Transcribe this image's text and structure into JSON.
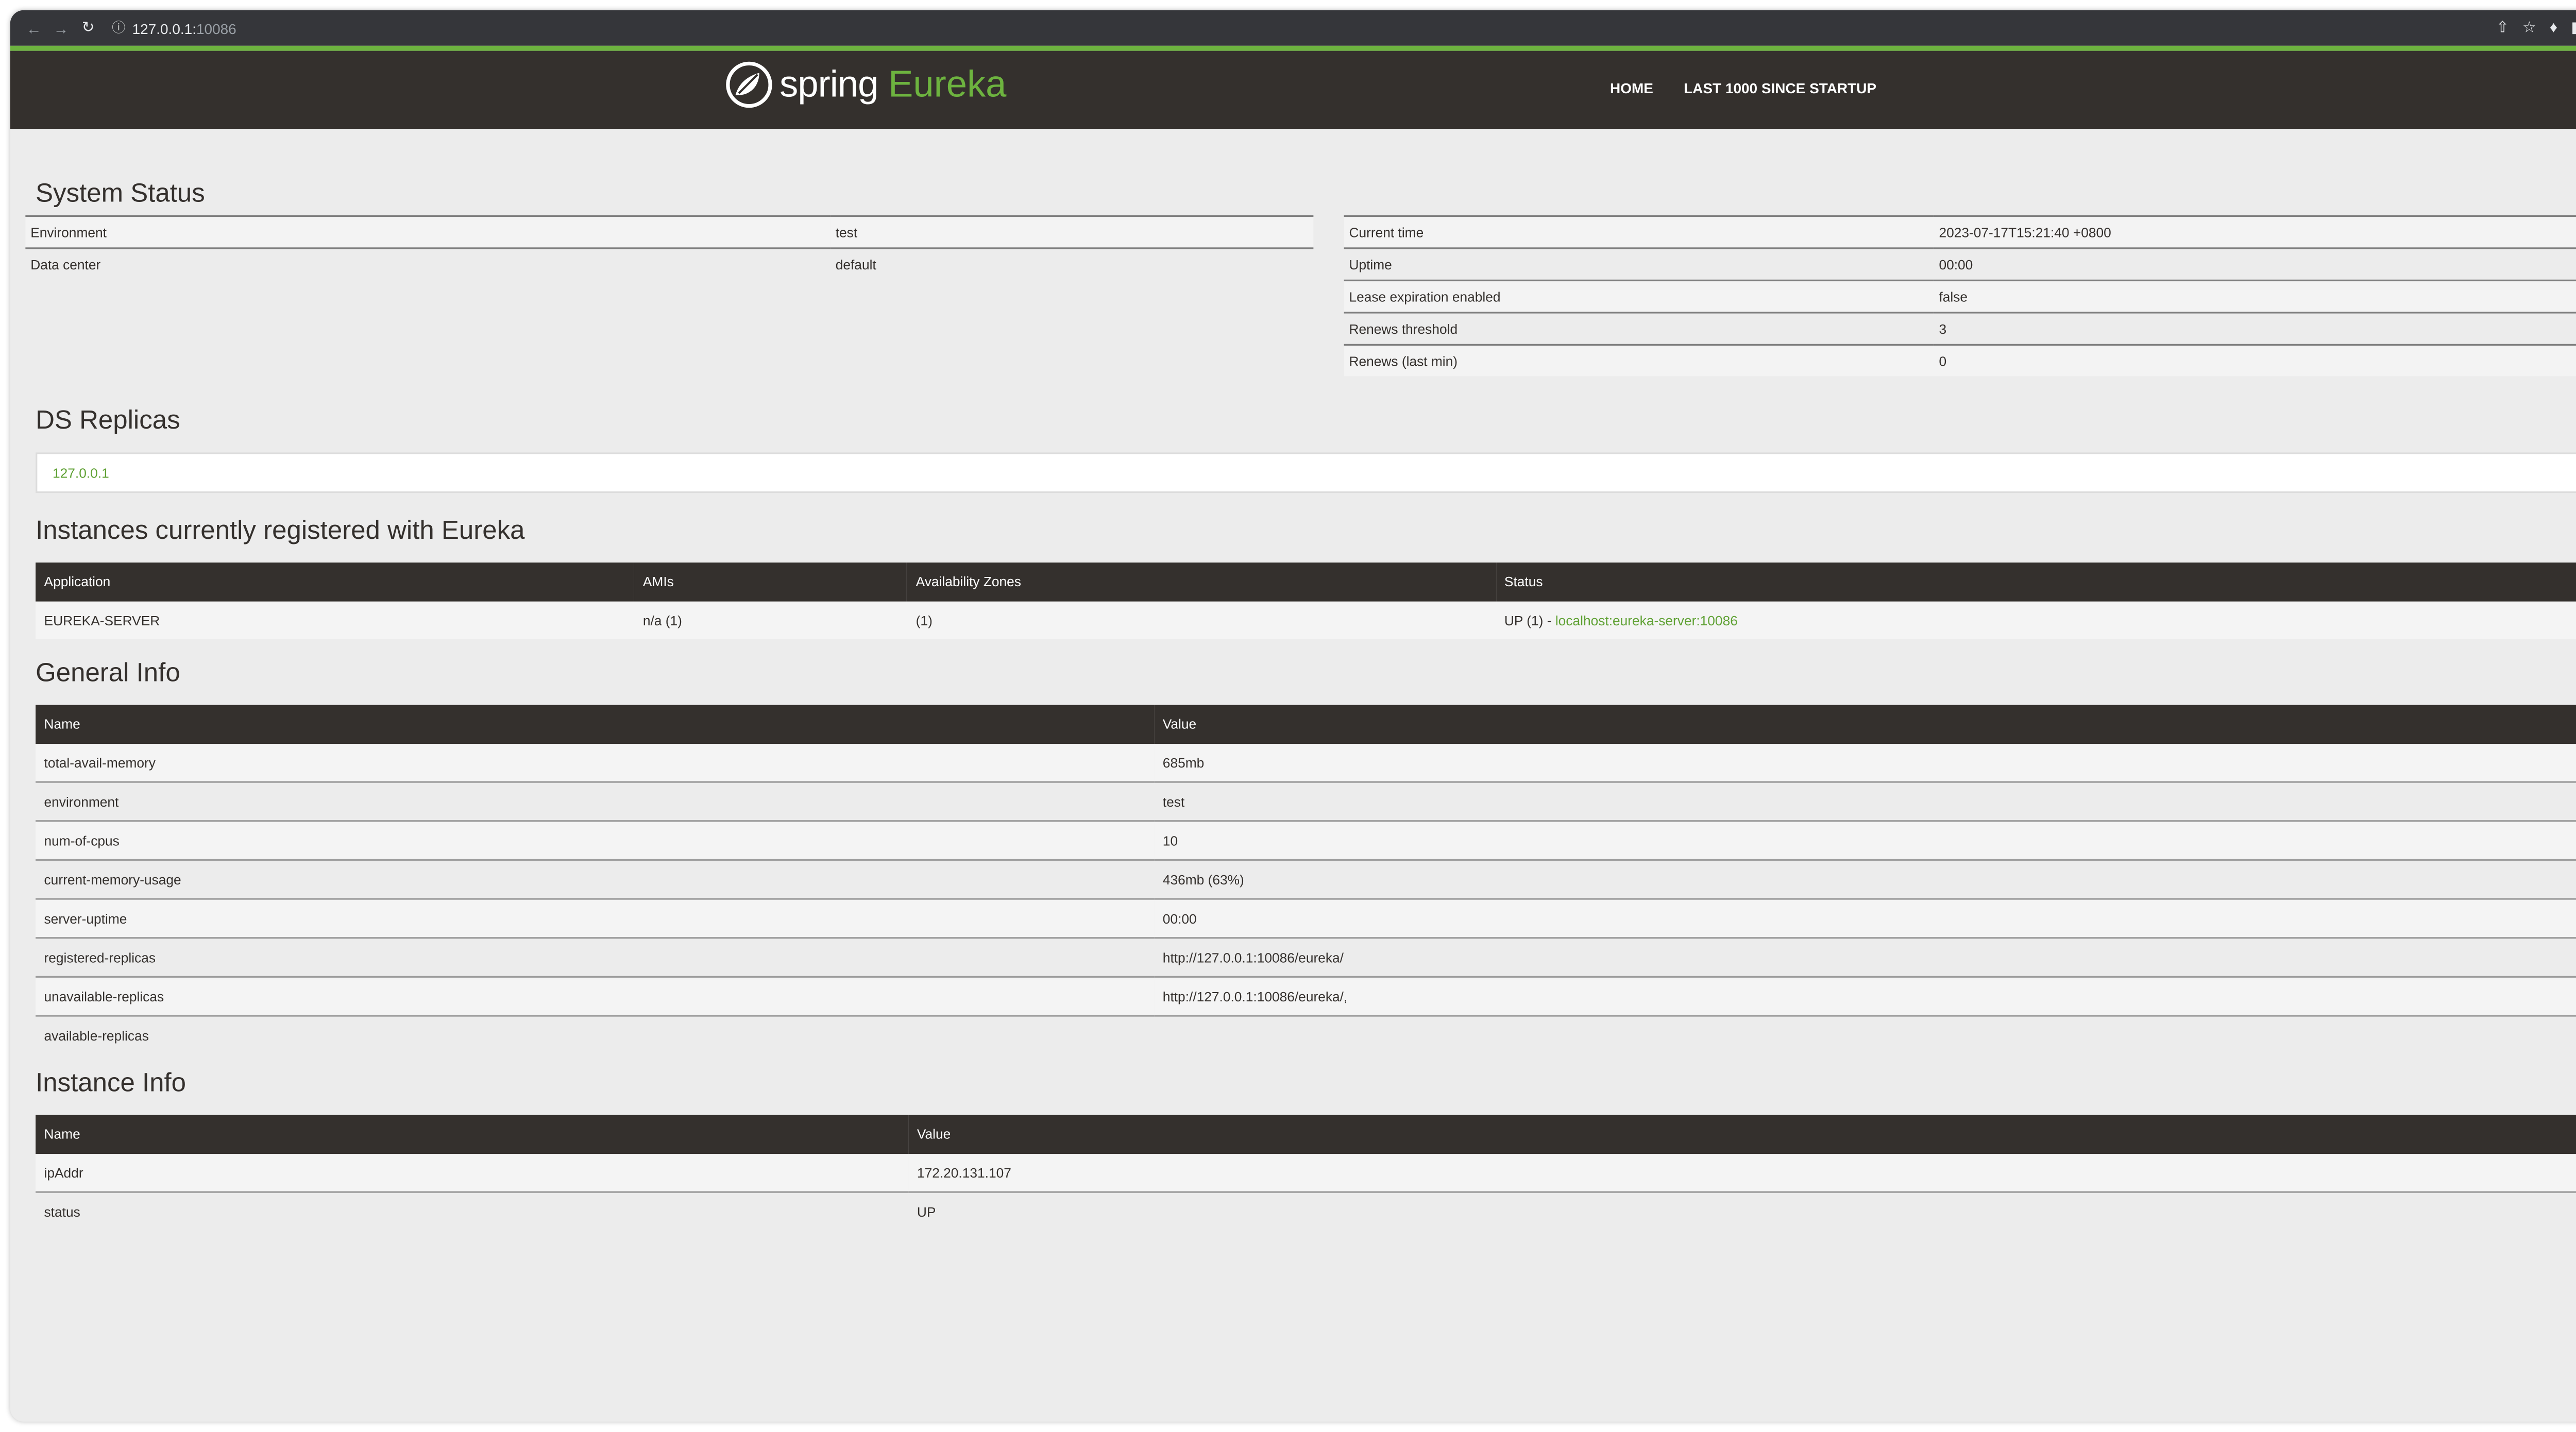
{
  "browser": {
    "url_host": "127.0.0.1:",
    "url_port": "10086",
    "icons": [
      "back-icon",
      "forward-icon",
      "reload-icon",
      "info-icon",
      "share-icon",
      "star-icon",
      "extensions-icon",
      "sidebar-icon",
      "profile-icon",
      "menu-icon"
    ]
  },
  "header": {
    "logo_spring": "spring",
    "logo_eureka": "Eureka",
    "nav": [
      "HOME",
      "LAST 1000 SINCE STARTUP"
    ]
  },
  "system_status": {
    "title": "System Status",
    "left": [
      {
        "key": "Environment",
        "value": "test"
      },
      {
        "key": "Data center",
        "value": "default"
      }
    ],
    "right": [
      {
        "key": "Current time",
        "value": "2023-07-17T15:21:40 +0800"
      },
      {
        "key": "Uptime",
        "value": "00:00"
      },
      {
        "key": "Lease expiration enabled",
        "value": "false"
      },
      {
        "key": "Renews threshold",
        "value": "3"
      },
      {
        "key": "Renews (last min)",
        "value": "0"
      }
    ]
  },
  "ds_replicas": {
    "title": "DS Replicas",
    "items": [
      "127.0.0.1"
    ]
  },
  "instances": {
    "title": "Instances currently registered with Eureka",
    "headers": [
      "Application",
      "AMIs",
      "Availability Zones",
      "Status"
    ],
    "rows": [
      {
        "application": "EUREKA-SERVER",
        "amis": "n/a (1)",
        "zones": "(1)",
        "status_prefix": "UP (1) - ",
        "status_link": "localhost:eureka-server:10086"
      }
    ]
  },
  "general_info": {
    "title": "General Info",
    "headers": [
      "Name",
      "Value"
    ],
    "rows": [
      {
        "name": "total-avail-memory",
        "value": "685mb"
      },
      {
        "name": "environment",
        "value": "test"
      },
      {
        "name": "num-of-cpus",
        "value": "10"
      },
      {
        "name": "current-memory-usage",
        "value": "436mb (63%)"
      },
      {
        "name": "server-uptime",
        "value": "00:00"
      },
      {
        "name": "registered-replicas",
        "value": "http://127.0.0.1:10086/eureka/"
      },
      {
        "name": "unavailable-replicas",
        "value": "http://127.0.0.1:10086/eureka/,"
      },
      {
        "name": "available-replicas",
        "value": ""
      }
    ]
  },
  "instance_info": {
    "title": "Instance Info",
    "headers": [
      "Name",
      "Value"
    ],
    "rows": [
      {
        "name": "ipAddr",
        "value": "172.20.131.107"
      },
      {
        "name": "status",
        "value": "UP"
      }
    ]
  }
}
